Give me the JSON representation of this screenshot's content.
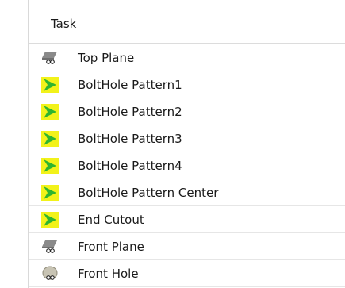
{
  "header": {
    "title": "Task"
  },
  "colors": {
    "highlight": "#f2f21a",
    "arrow": "#2fb52f",
    "plane_gray": "#8a8a8a",
    "hole_gray": "#c8c4b4"
  },
  "rows": [
    {
      "label": "Top Plane",
      "icon": "plane-icon"
    },
    {
      "label": "BoltHole Pattern1",
      "icon": "play-arrow-icon"
    },
    {
      "label": "BoltHole Pattern2",
      "icon": "play-arrow-icon"
    },
    {
      "label": "BoltHole Pattern3",
      "icon": "play-arrow-icon"
    },
    {
      "label": "BoltHole Pattern4",
      "icon": "play-arrow-icon"
    },
    {
      "label": "BoltHole Pattern Center",
      "icon": "play-arrow-icon"
    },
    {
      "label": "End Cutout",
      "icon": "play-arrow-icon"
    },
    {
      "label": "Front Plane",
      "icon": "plane-icon"
    },
    {
      "label": "Front Hole",
      "icon": "hole-icon"
    }
  ]
}
